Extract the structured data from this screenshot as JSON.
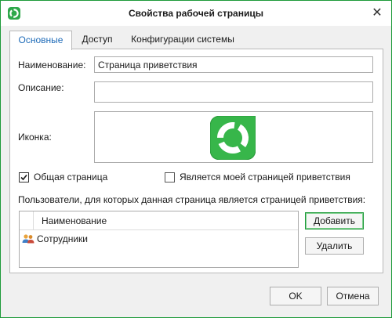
{
  "window": {
    "title": "Свойства рабочей страницы",
    "close_glyph": "✕",
    "accent_color": "#1e9a3a"
  },
  "tabs": [
    {
      "label": "Основные",
      "active": true
    },
    {
      "label": "Доступ",
      "active": false
    },
    {
      "label": "Конфигурации системы",
      "active": false
    }
  ],
  "form": {
    "name_label": "Наименование:",
    "name_value": "Страница приветствия",
    "description_label": "Описание:",
    "description_value": "",
    "icon_label": "Иконка:",
    "icon_name": "green-ring-logo-icon"
  },
  "checkboxes": {
    "shared": {
      "label": "Общая страница",
      "checked": true
    },
    "my_welcome": {
      "label": "Является моей страницей приветствия",
      "checked": false
    }
  },
  "users": {
    "caption": "Пользователи, для которых данная страница является страницей приветствия:",
    "column_header": "Наименование",
    "rows": [
      {
        "label": "Сотрудники",
        "icon": "users-group-icon"
      }
    ],
    "add_label": "Добавить",
    "remove_label": "Удалить"
  },
  "footer": {
    "ok_label": "OK",
    "cancel_label": "Отмена"
  }
}
